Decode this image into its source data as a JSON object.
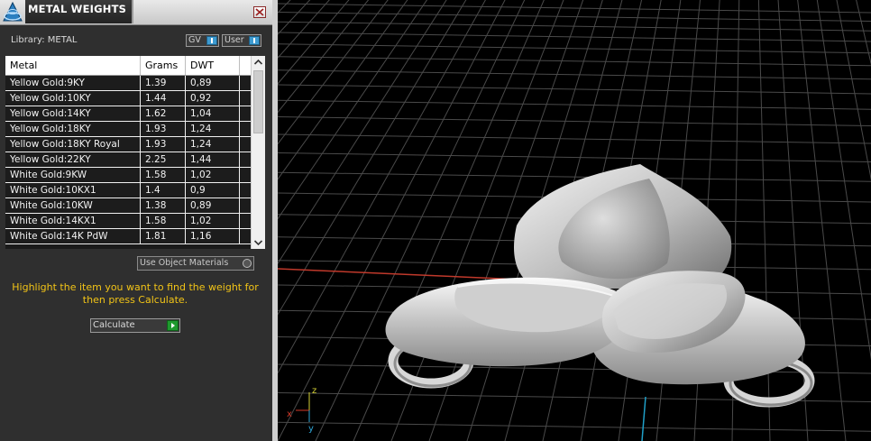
{
  "panel": {
    "title": "METAL WEIGHTS",
    "library_label": "Library: METAL",
    "gv_label": "GV",
    "user_label": "User",
    "use_object_materials": "Use Object Materials",
    "hint": "Highlight the item you want to find the weight for then press Calculate.",
    "calculate_label": "Calculate"
  },
  "table": {
    "columns": [
      "Metal",
      "Grams",
      "DWT"
    ],
    "rows": [
      {
        "metal": "Yellow Gold:9KY",
        "grams": "1.39",
        "dwt": "0,89"
      },
      {
        "metal": "Yellow Gold:10KY",
        "grams": "1.44",
        "dwt": "0,92"
      },
      {
        "metal": "Yellow Gold:14KY",
        "grams": "1.62",
        "dwt": "1,04"
      },
      {
        "metal": "Yellow Gold:18KY",
        "grams": "1.93",
        "dwt": "1,24"
      },
      {
        "metal": "Yellow Gold:18KY Royal",
        "grams": "1.93",
        "dwt": "1,24"
      },
      {
        "metal": "Yellow Gold:22KY",
        "grams": "2.25",
        "dwt": "1,44"
      },
      {
        "metal": "White Gold:9KW",
        "grams": "1.58",
        "dwt": "1,02"
      },
      {
        "metal": "White Gold:10KX1",
        "grams": "1.4",
        "dwt": "0,9"
      },
      {
        "metal": "White Gold:10KW",
        "grams": "1.38",
        "dwt": "0,89"
      },
      {
        "metal": "White Gold:14KX1",
        "grams": "1.58",
        "dwt": "1,02"
      },
      {
        "metal": "White Gold:14K PdW",
        "grams": "1.81",
        "dwt": "1,16"
      }
    ]
  },
  "viewport": {
    "axis_z": "z",
    "axis_x": "x",
    "axis_y": "y"
  },
  "colors": {
    "hint": "#f2c417",
    "accent_blue": "#3d9bd1",
    "calc_green": "#1e9a2e",
    "x_axis": "#c0392b",
    "y_axis": "#1fa0c8"
  },
  "icons": [
    "app-logo-icon",
    "close-icon",
    "scroll-up-icon",
    "scroll-down-icon",
    "play-icon"
  ]
}
